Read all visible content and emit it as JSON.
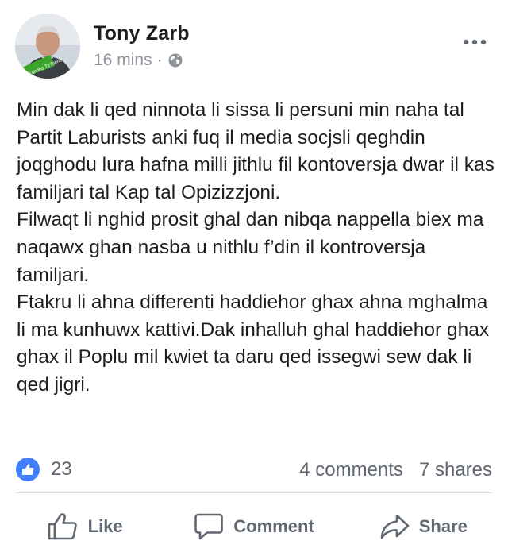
{
  "post": {
    "author": "Tony Zarb",
    "time": "16 mins",
    "separator": "·",
    "privacy_icon": "globe-icon",
    "more_icon": "more-options-icon",
    "avatar_badge": "Kandha Ta Siens",
    "body": [
      "Min dak li qed ninnota li sissa li persuni min naha tal Partit Laburists anki fuq il media socjsli qeghdin joqghodu lura hafna milli jithlu fil kontoversja dwar il kas familjari tal Kap tal Opizizzjoni.",
      "Filwaqt li nghid prosit ghal dan nibqa nappella biex ma naqawx ghan nasba u nithlu f’din il kontroversja familjari.",
      "Ftakru li ahna differenti haddiehor ghax ahna mghalma li ma kunhuwx kattivi.Dak inhalluh ghal haddiehor ghax ghax il Poplu mil kwiet ta daru qed issegwi sew dak li qed jigri."
    ]
  },
  "engagement": {
    "reaction_icon": "like-reaction-icon",
    "reaction_count": "23",
    "comments": "4 comments",
    "shares": "7 shares"
  },
  "actions": {
    "like": "Like",
    "comment": "Comment",
    "share": "Share"
  },
  "colors": {
    "text": "#1c1e21",
    "muted": "#90949c",
    "action_gray": "#606770",
    "like_blue": "#4080ff",
    "divider": "#dadde1",
    "badge_green": "#3aa52a"
  }
}
